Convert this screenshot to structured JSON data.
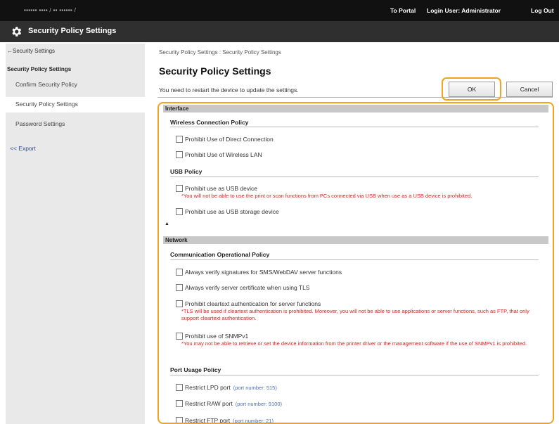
{
  "topbar": {
    "host": "▪▪▪▪▪▪ ▪▪▪▪ / ▪▪ ▪▪▪▪▪▪ /",
    "to_portal": "To Portal",
    "login_user": "Login User:  Administrator",
    "log_out": "Log Out"
  },
  "titlebar": {
    "title": "Security Policy Settings"
  },
  "sidebar": {
    "back": "←Security Settings",
    "section": "Security Policy Settings",
    "items": [
      "Confirm Security Policy",
      "Security Policy Settings",
      "Password Settings"
    ],
    "export": "<< Export"
  },
  "main": {
    "breadcrumb": "Security Policy Settings : Security Policy Settings",
    "title": "Security Policy Settings",
    "restart_msg": "You need to restart the device to update the settings.",
    "ok": "OK",
    "cancel": "Cancel"
  },
  "interface": {
    "header": "Interface",
    "wireless_title": "Wireless Connection Policy",
    "opt_direct": "Prohibit Use of Direct Connection",
    "opt_wlan": "Prohibit Use of Wireless LAN",
    "usb_title": "USB Policy",
    "opt_usb_device": "Prohibit use as USB device",
    "note_usb": "*You will not be able to use the print or scan functions from PCs connected via USB when use as a USB device is prohibited.",
    "opt_usb_storage": "Prohibit use as USB storage device",
    "expander": "▲"
  },
  "network": {
    "header": "Network",
    "comm_title": "Communication Operational Policy",
    "opt_sig": "Always verify signatures for SMS/WebDAV server functions",
    "opt_cert": "Always verify server certificate when using TLS",
    "opt_cleartext": "Prohibit cleartext authentication for server functions",
    "note_cleartext": "*TLS will be used if cleartext authentication is prohibited. Moreover, you will not be able to use applications or server functions, such as FTP, that only support cleartext authentication.",
    "opt_snmp": "Prohibit use of SNMPv1",
    "note_snmp": "*You may not be able to retrieve or set the device information from the printer driver or the management software if the use of SNMPv1 is prohibited.",
    "port_title": "Port Usage Policy",
    "opt_lpd": "Restrict LPD port",
    "lpd_port": "(port number: 515)",
    "opt_raw": "Restrict RAW port",
    "raw_port": "(port number: 9100)",
    "opt_ftp": "Restrict FTP port",
    "ftp_port": "(port number: 21)"
  },
  "colors": {
    "highlight": "#f3a21f",
    "note": "#d9231b",
    "port_link": "#4a6fb0",
    "header_bg": "#111111"
  },
  "icons": {
    "title_icon": "gear-icon",
    "expander_icon": "collapse-arrow-icon"
  }
}
